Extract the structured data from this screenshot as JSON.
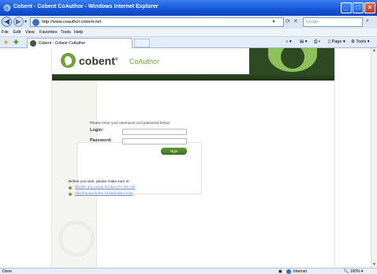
{
  "window": {
    "title": "Cobent - Cobent CoAuthor - Windows Internet Explorer"
  },
  "address_bar": {
    "url": "http://www.coauthor.cobent.net",
    "search_placeholder": "Google"
  },
  "menu": [
    "File",
    "Edit",
    "View",
    "Favorites",
    "Tools",
    "Help"
  ],
  "tabs": [
    {
      "label": "Cobent - Cobent CoAuthor"
    }
  ],
  "command_bar": {
    "page_label": "Page",
    "tools_label": "Tools"
  },
  "site": {
    "brand": "cobent",
    "brand_mark": "®",
    "product": "CoAuthor"
  },
  "login": {
    "prompt": "Please enter your username and password below:",
    "login_label": "Login:",
    "password_label": "Password:",
    "button_label": "login"
  },
  "notes": {
    "heading": "Before you start, please make sure to:",
    "items": [
      "Disable any popup blockers for this site",
      "Add this site to the Trusted Sites zone"
    ]
  },
  "status_bar": {
    "status": "Done",
    "zone": "Internet",
    "zoom": "100%"
  },
  "colors": {
    "accent_green": "#6ea33a",
    "header_dark": "#2d4a22",
    "titlebar_blue": "#1455d6"
  }
}
